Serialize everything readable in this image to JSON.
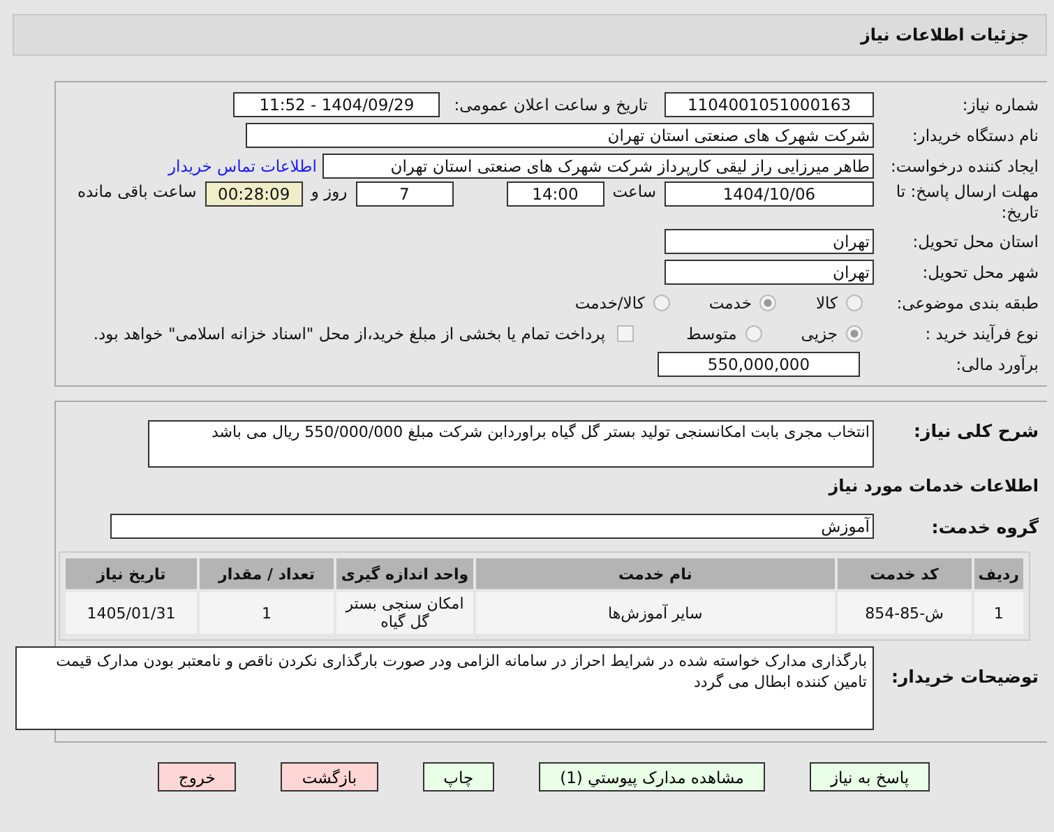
{
  "header": {
    "title": "جزئیات اطلاعات نیاز"
  },
  "form": {
    "need_number_label": "شماره نیاز:",
    "need_number": "1104001051000163",
    "announce_label": "تاریخ و ساعت اعلان عمومی:",
    "announce_value": "1404/09/29 - 11:52",
    "buyer_label": "نام دستگاه خریدار:",
    "buyer": "شرکت شهرک های صنعتی استان تهران",
    "creator_label": "ایجاد کننده درخواست:",
    "creator": "طاهر  میرزایی راز لیقی کارپرداز شرکت شهرک های صنعتی استان تهران",
    "contact_link": "اطلاعات تماس خریدار",
    "deadline_label": "مهلت ارسال پاسخ: تا تاریخ:",
    "deadline_date": "1404/10/06",
    "time_label": "ساعت",
    "deadline_time": "14:00",
    "days": "7",
    "days_label": "روز و",
    "remaining": "00:28:09",
    "remaining_label": "ساعت باقی مانده",
    "province_label": "استان محل تحویل:",
    "province": "تهران",
    "city_label": "شهر محل تحویل:",
    "city": "تهران",
    "category_label": "طبقه بندی موضوعی:",
    "category_options": [
      {
        "label": "کالا",
        "selected": false
      },
      {
        "label": "خدمت",
        "selected": true
      },
      {
        "label": "کالا/خدمت",
        "selected": false
      }
    ],
    "process_label": "نوع فرآیند خرید :",
    "process_options": [
      {
        "label": "جزیی",
        "selected": true
      },
      {
        "label": "متوسط",
        "selected": false
      }
    ],
    "treasury": {
      "label": "پرداخت تمام یا بخشی از مبلغ خرید،از محل \"اسناد خزانه اسلامی\" خواهد بود.",
      "checked": false
    },
    "budget_label": "برآورد مالی:",
    "budget": "550,000,000"
  },
  "details": {
    "summary_label": "شرح کلی نیاز:",
    "summary": "انتخاب مجری بابت امکانسنجی تولید بستر گل گیاه براوردابن شرکت مبلغ 550/000/000 ریال می باشد",
    "services_heading": "اطلاعات خدمات مورد نیاز",
    "group_label": "گروه خدمت:",
    "group": "آموزش",
    "table": {
      "columns": [
        "ردیف",
        "کد خدمت",
        "نام خدمت",
        "واحد اندازه گیری",
        "تعداد / مقدار",
        "تاریخ نیاز"
      ],
      "rows": [
        [
          "1",
          "ش-85-854",
          "سایر آموزش‌ها",
          "امکان سنجی بستر گل گیاه",
          "1",
          "1405/01/31"
        ]
      ]
    },
    "comments_label": "توضیحات خریدار:",
    "comments": "بارگذاری مدارک خواسته شده در شرایط احراز در سامانه الزامی ودر صورت بارگذاری نکردن ناقص و نامعتبر بودن مدارک قیمت تامین  کننده ابطال می گردد"
  },
  "buttons": [
    {
      "label": "پاسخ به نیاز",
      "kind": "normal"
    },
    {
      "label": "مشاهده مدارک پیوستي (1)",
      "kind": "normal"
    },
    {
      "label": "چاپ",
      "kind": "normal"
    },
    {
      "label": "بازگشت",
      "kind": "danger"
    },
    {
      "label": "خروج",
      "kind": "danger"
    }
  ]
}
